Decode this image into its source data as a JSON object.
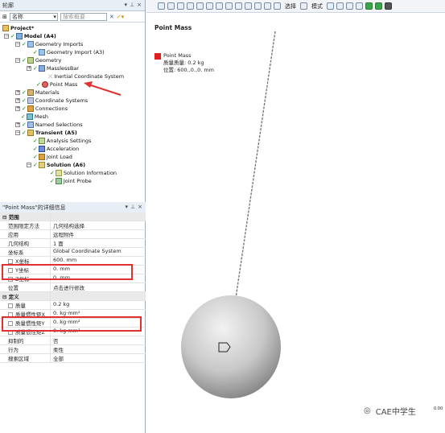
{
  "outline_panel": {
    "title": "轮廓",
    "name_filter": "名称",
    "search_placeholder": "搜索概要"
  },
  "tree": {
    "project": "Project*",
    "model": "Model (A4)",
    "geometry_imports": "Geometry Imports",
    "geometry_import": "Geometry Import (A3)",
    "geometry": "Geometry",
    "massless_bar": "MasslessBar",
    "inertial_cs": "Inertial Coordinate System",
    "point_mass": "Point Mass",
    "materials": "Materials",
    "coordinate_systems": "Coordinate Systems",
    "connections": "Connections",
    "mesh": "Mesh",
    "named_selections": "Named Selections",
    "transient": "Transient (A5)",
    "analysis_settings": "Analysis Settings",
    "acceleration": "Acceleration",
    "joint_load": "Joint Load",
    "solution": "Solution (A6)",
    "solution_information": "Solution Information",
    "joint_probe": "Joint Probe"
  },
  "details_panel": {
    "title": "\"Point Mass\"的详细信息",
    "rows": [
      {
        "k": "范围",
        "v": "",
        "group": true
      },
      {
        "k": "范围限定方法",
        "v": "几何结构选择"
      },
      {
        "k": "应用",
        "v": "远程附件"
      },
      {
        "k": "几何结构",
        "v": "1 面"
      },
      {
        "k": "坐标系",
        "v": "Global Coordinate System"
      },
      {
        "k": "X坐标",
        "v": "600. mm",
        "cb": true
      },
      {
        "k": "Y坐标",
        "v": "0. mm",
        "cb": true
      },
      {
        "k": "Z坐标",
        "v": "0. mm",
        "cb": true
      },
      {
        "k": "位置",
        "v": "点击进行修改"
      },
      {
        "k": "定义",
        "v": "",
        "group": true
      },
      {
        "k": "质量",
        "v": "0.2 kg",
        "cb": true
      },
      {
        "k": "质量惯性矩X",
        "v": "0. kg·mm²",
        "cb": true
      },
      {
        "k": "质量惯性矩Y",
        "v": "0. kg·mm²",
        "cb": true
      },
      {
        "k": "质量惯性矩Z",
        "v": "0. kg·mm²",
        "cb": true
      },
      {
        "k": "抑制的",
        "v": "否"
      },
      {
        "k": "行为",
        "v": "柔性"
      },
      {
        "k": "搜索区域",
        "v": "全部"
      }
    ]
  },
  "toolbar": {
    "select_label": "选择",
    "mode_label": "模式"
  },
  "viewport": {
    "title": "Point Mass",
    "legend_label": "Point Mass",
    "mass_line": "质量质量: 0.2 kg",
    "position_line": "位置: 600.,0.,0. mm"
  },
  "watermark": "CAE中学生",
  "corner_value": "0.00",
  "colors": {
    "accent_red": "#e03030",
    "legend_red": "#e02020",
    "sphere": "#c8c8c8"
  }
}
